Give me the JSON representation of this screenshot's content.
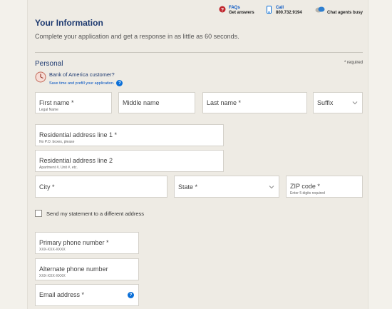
{
  "header": {
    "faqs_label": "FAQs",
    "faqs_sub": "Get answers",
    "call_label": "Call",
    "call_number": "800.732.9194",
    "chat_label": "Chat agents busy"
  },
  "page": {
    "title": "Your Information",
    "intro": "Complete your application and get a response in as little as 60 seconds."
  },
  "section": {
    "title": "Personal",
    "required_note": "* required"
  },
  "boa": {
    "question": "Bank of America customer?",
    "prefill": "Save time and prefill your application."
  },
  "fields": {
    "first_name": {
      "label": "First name *",
      "hint": "Legal Name"
    },
    "middle_name": {
      "label": "Middle name"
    },
    "last_name": {
      "label": "Last name *"
    },
    "suffix": {
      "label": "Suffix"
    },
    "address1": {
      "label": "Residential address line 1 *",
      "hint": "No P.O. boxes, please"
    },
    "address2": {
      "label": "Residential address line 2",
      "hint": "Apartment #, Unit #, etc."
    },
    "city": {
      "label": "City *"
    },
    "state": {
      "label": "State *"
    },
    "zip": {
      "label": "ZIP code *",
      "hint": "Enter 5 digits required"
    },
    "primary_phone": {
      "label": "Primary phone number *",
      "hint": "XXX-XXX-XXXX"
    },
    "alt_phone": {
      "label": "Alternate phone number",
      "hint": "XXX-XXX-XXXX"
    },
    "email": {
      "label": "Email address *"
    }
  },
  "statement_checkbox": {
    "label": "Send my statement to a different address",
    "checked": false
  },
  "colors": {
    "title": "#1e3a70",
    "link": "#0052c2",
    "help": "#0a6fd8",
    "panel": "#eeebe4"
  }
}
